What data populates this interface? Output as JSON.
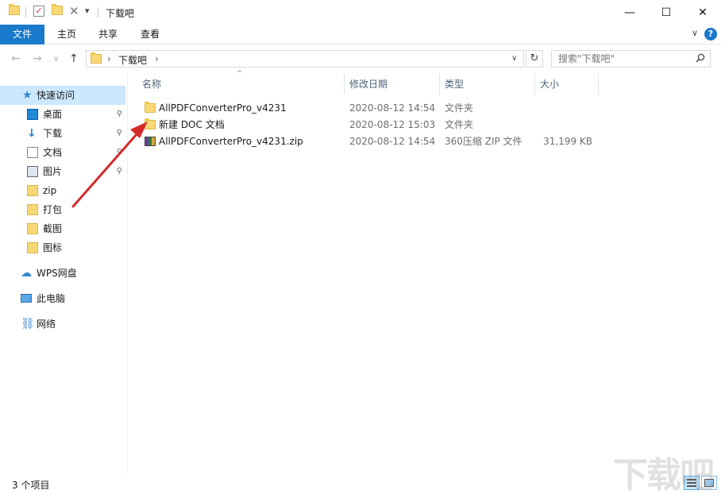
{
  "window": {
    "title": "下载吧",
    "minimize_glyph": "—",
    "maximize_glyph": "☐",
    "close_glyph": "✕"
  },
  "quick_access_toolbar": {
    "dropdown_glyph": "▾",
    "delete_glyph": "✕"
  },
  "ribbon": {
    "tabs": [
      {
        "label": "文件",
        "active": true
      },
      {
        "label": "主页"
      },
      {
        "label": "共享"
      },
      {
        "label": "查看"
      }
    ],
    "expand_glyph": "∨",
    "help_glyph": "?"
  },
  "address": {
    "back_glyph": "←",
    "forward_glyph": "→",
    "recent_glyph": "∨",
    "up_glyph": "↑",
    "breadcrumb_sep": "›",
    "folder": "下载吧",
    "trailing_sep": "›",
    "dropdown_glyph": "∨",
    "refresh_glyph": "↻"
  },
  "search": {
    "placeholder": "搜索\"下载吧\"",
    "icon": "search-icon"
  },
  "nav": {
    "quick_access": "快速访问",
    "items": [
      {
        "label": "桌面",
        "icon": "desktop-icon",
        "pinned": true
      },
      {
        "label": "下载",
        "icon": "download-icon",
        "pinned": true
      },
      {
        "label": "文档",
        "icon": "document-icon",
        "pinned": true
      },
      {
        "label": "图片",
        "icon": "pictures-icon",
        "pinned": true
      },
      {
        "label": "zip",
        "icon": "folder-icon"
      },
      {
        "label": "打包",
        "icon": "folder-icon"
      },
      {
        "label": "截图",
        "icon": "folder-icon"
      },
      {
        "label": "图标",
        "icon": "folder-icon"
      }
    ],
    "pin_glyph": "📌",
    "wps": "WPS网盘",
    "this_pc": "此电脑",
    "network": "网络"
  },
  "columns": {
    "name": "名称",
    "date": "修改日期",
    "type": "类型",
    "size": "大小",
    "sort_glyph": "^"
  },
  "files": [
    {
      "name": "AllPDFConverterPro_v4231",
      "date": "2020-08-12 14:54",
      "type": "文件夹",
      "size": "",
      "icon": "folder-icon"
    },
    {
      "name": "新建 DOC 文档",
      "date": "2020-08-12 15:03",
      "type": "文件夹",
      "size": "",
      "icon": "folder-icon"
    },
    {
      "name": "AllPDFConverterPro_v4231.zip",
      "date": "2020-08-12 14:54",
      "type": "360压缩 ZIP 文件",
      "size": "31,199 KB",
      "icon": "zip-archive-icon"
    }
  ],
  "status": {
    "item_count": "3 个项目"
  },
  "watermark": "下载吧",
  "colors": {
    "accent": "#1979ca",
    "selection": "#cce8ff",
    "annotation_arrow": "#d42a2a"
  }
}
